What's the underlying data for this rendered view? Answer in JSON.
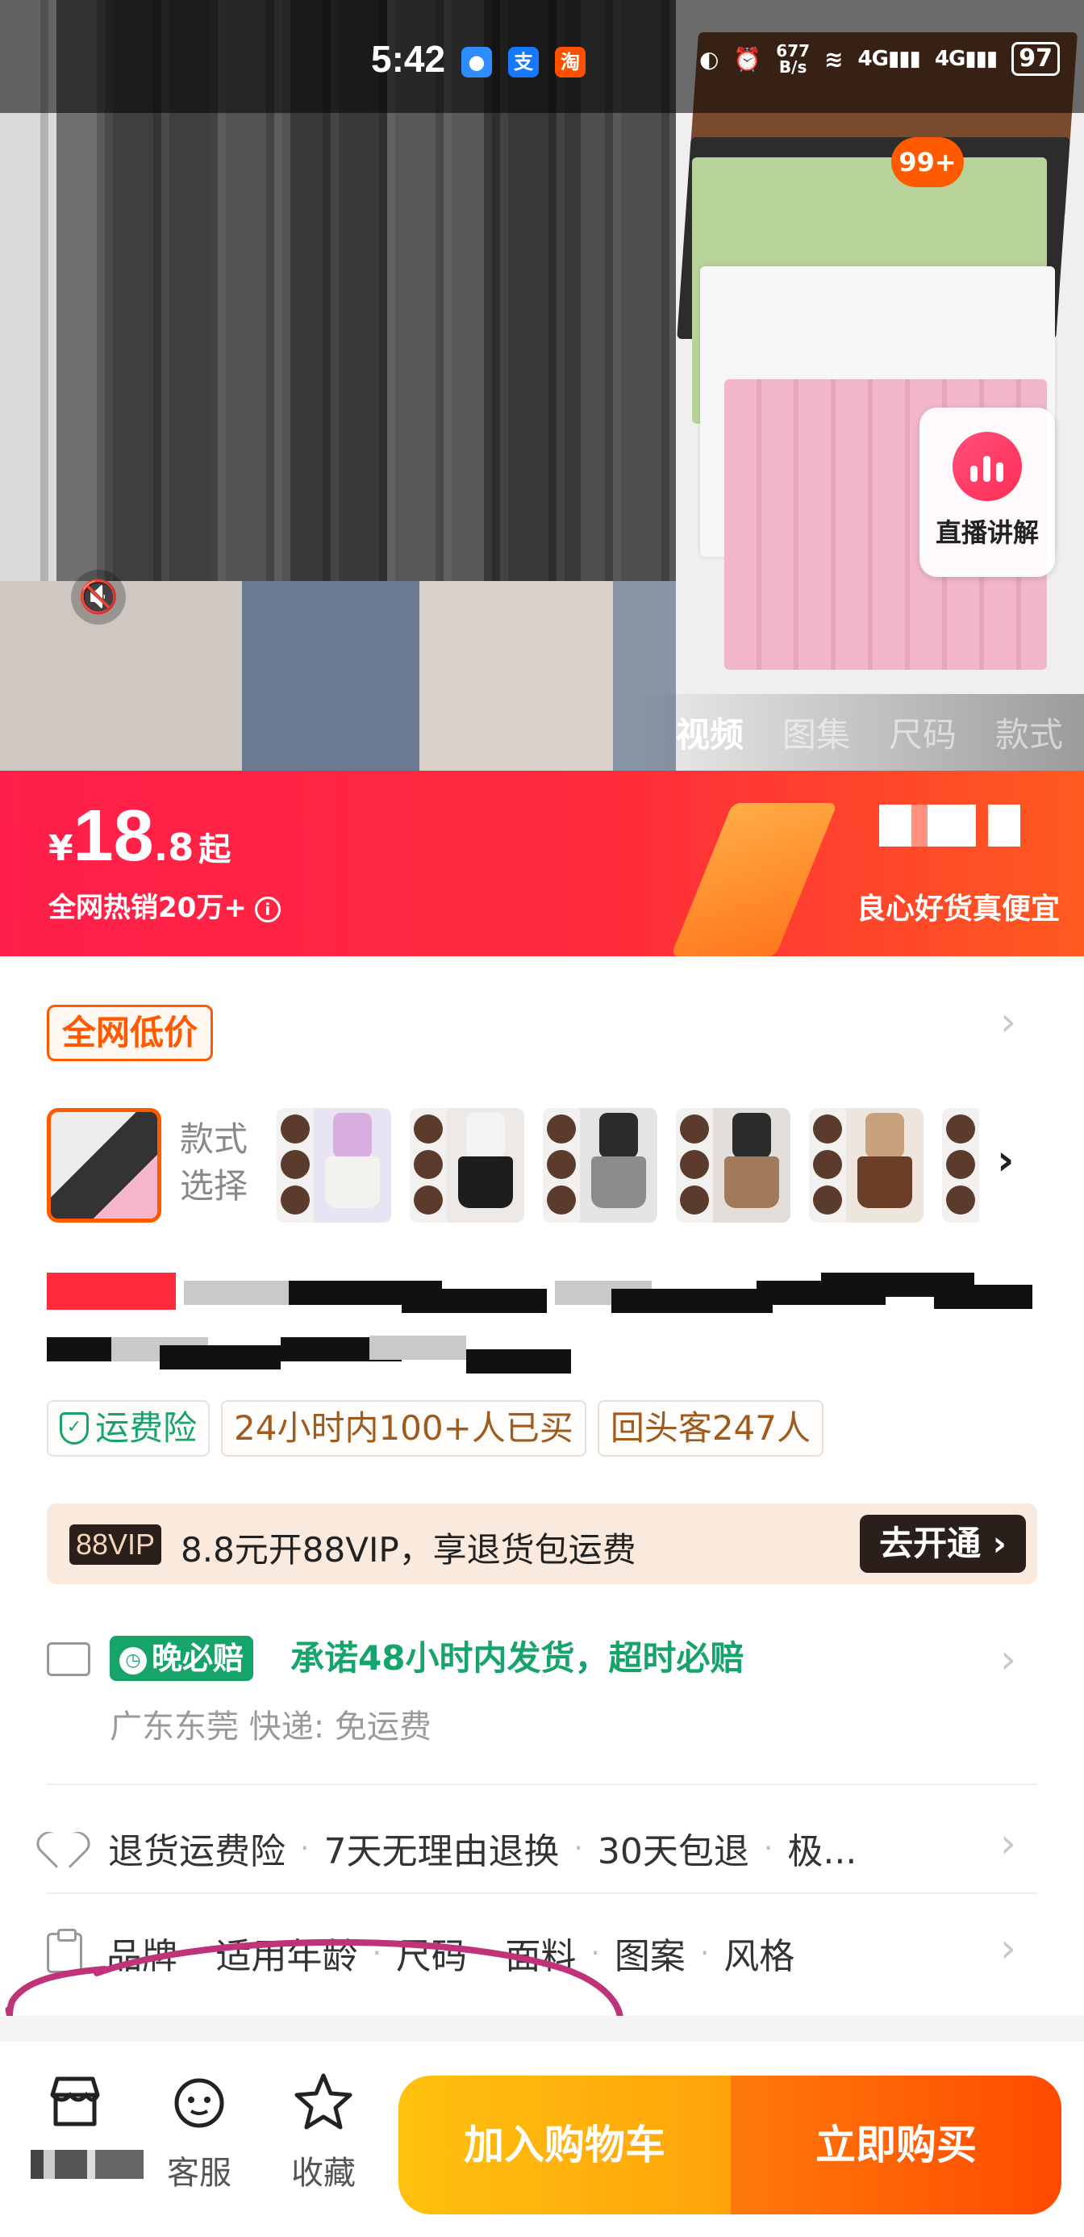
{
  "status_bar": {
    "time": "5:42",
    "network_speed": "677\nB/s",
    "signal_1": "4G",
    "signal_2": "4G",
    "battery": "97"
  },
  "media": {
    "cart_badge": "99+",
    "live_label": "直播讲解",
    "tabs": [
      "视频",
      "图集",
      "尺码",
      "款式"
    ],
    "active_tab": "视频"
  },
  "price_banner": {
    "currency": "¥",
    "price_int": "18",
    "price_dec": ".8",
    "price_suffix": "起",
    "hot_sales": "全网热销20万+",
    "slogan": "良心好货真便宜"
  },
  "low_price_tag": "全网低价",
  "style_selector": {
    "label_line1": "款式",
    "label_line2": "选择"
  },
  "tags": [
    {
      "text": "运费险"
    },
    {
      "text": "24小时内100+人已买"
    },
    {
      "text": "回头客247人"
    }
  ],
  "vip": {
    "badge": "88VIP",
    "text": "8.8元开88VIP，享退货包运费",
    "button": "去开通 ›"
  },
  "shipping": {
    "badge": "晚必赔",
    "promise": "承诺48小时内发货，超时必赔",
    "origin": "广东东莞  快递: 免运费"
  },
  "services": [
    "退货运费险",
    "7天无理由退换",
    "30天包退",
    "极..."
  ],
  "attributes": [
    "品牌",
    "适用年龄",
    "尺码",
    "面料",
    "图案",
    "风格"
  ],
  "bottom_bar": {
    "service_label": "客服",
    "favorite_label": "收藏",
    "add_to_cart": "加入购物车",
    "buy_now": "立即购买"
  },
  "colors": {
    "brand_red": "#ff2a3c",
    "orange": "#ff5a00",
    "green": "#17a46a",
    "annotation": "#c0337a"
  }
}
